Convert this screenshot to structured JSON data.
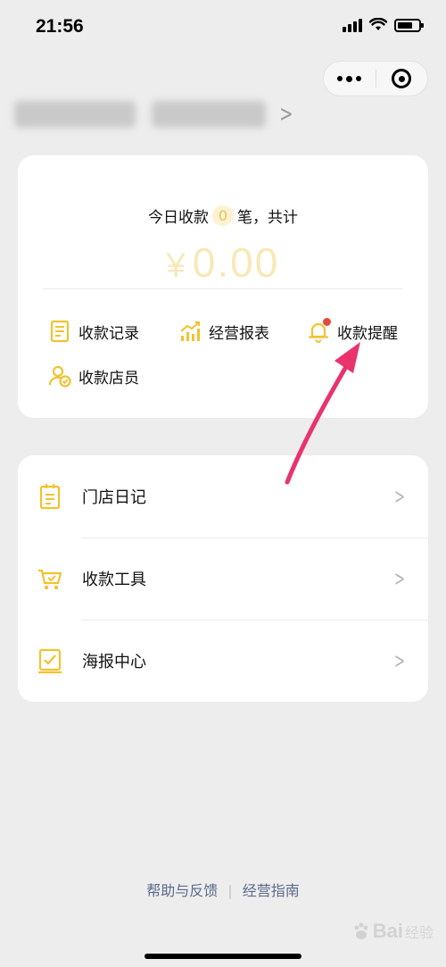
{
  "status_bar": {
    "time": "21:56"
  },
  "header": {
    "capsule_more": "more-icon",
    "capsule_close": "close-miniprogram-icon"
  },
  "summary": {
    "today_prefix": "今日收款",
    "count": "0",
    "today_suffix": "笔，共计",
    "currency": "¥",
    "amount": "0.00",
    "actions": [
      {
        "label": "收款记录",
        "icon": "receipt-icon"
      },
      {
        "label": "经营报表",
        "icon": "chart-icon"
      },
      {
        "label": "收款提醒",
        "icon": "bell-icon",
        "badge": true
      },
      {
        "label": "收款店员",
        "icon": "staff-icon"
      }
    ]
  },
  "menu": {
    "items": [
      {
        "label": "门店日记",
        "icon": "diary-icon"
      },
      {
        "label": "收款工具",
        "icon": "cart-tool-icon"
      },
      {
        "label": "海报中心",
        "icon": "poster-icon"
      }
    ]
  },
  "footer": {
    "help": "帮助与反馈",
    "divider": "|",
    "guide": "经营指南"
  },
  "watermark": {
    "text": "Bai",
    "sub": "经验"
  },
  "colors": {
    "accent_yellow": "#f2c230",
    "amount_color": "#f7e9b8",
    "link_blue": "#5a6b8c",
    "annotation_arrow": "#e8336d",
    "badge_red": "#e24b3b"
  }
}
